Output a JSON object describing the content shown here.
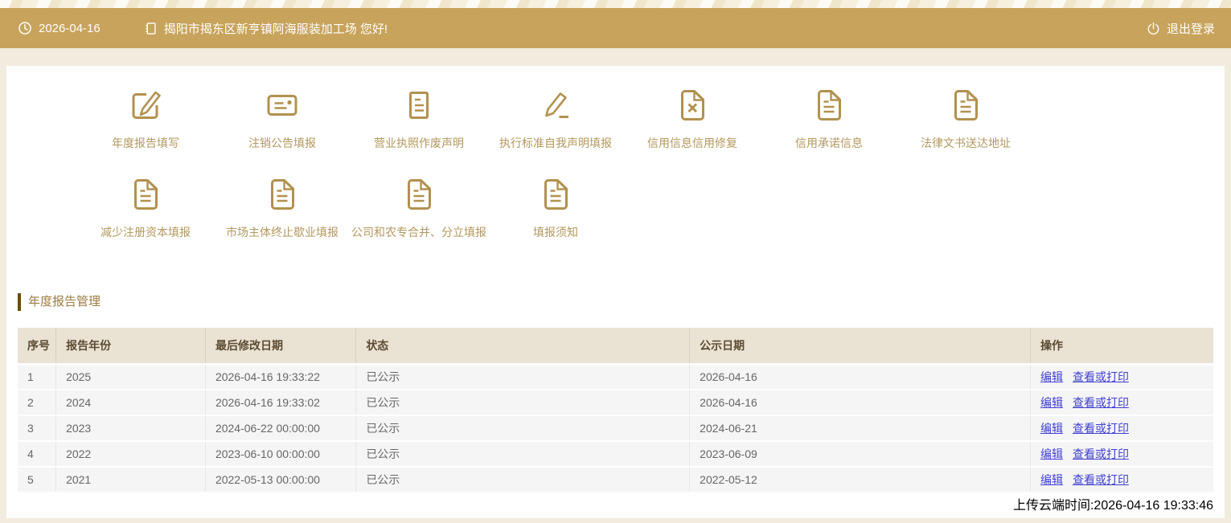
{
  "topbar": {
    "date": "2026-04-16",
    "welcome": "揭阳市揭东区新亨镇阿海服装加工场 您好!",
    "logout": "退出登录"
  },
  "menu": {
    "row1": [
      {
        "label": "年度报告填写",
        "icon": "edit-square-icon"
      },
      {
        "label": "注销公告填报",
        "icon": "card-note-icon"
      },
      {
        "label": "营业执照作废声明",
        "icon": "document-lines-icon"
      },
      {
        "label": "执行标准自我声明填报",
        "icon": "pencil-underline-icon"
      },
      {
        "label": "信用信息信用修复",
        "icon": "file-x-icon"
      },
      {
        "label": "信用承诺信息",
        "icon": "file-text-icon"
      },
      {
        "label": "法律文书送达地址",
        "icon": "file-text-icon"
      }
    ],
    "row2": [
      {
        "label": "减少注册资本填报",
        "icon": "file-text-icon"
      },
      {
        "label": "市场主体终止歇业填报",
        "icon": "file-text-icon"
      },
      {
        "label": "公司和农专合并、分立填报",
        "icon": "file-text-icon"
      },
      {
        "label": "填报须知",
        "icon": "file-text-icon"
      }
    ]
  },
  "section": {
    "title": "年度报告管理"
  },
  "table": {
    "headers": [
      "序号",
      "报告年份",
      "最后修改日期",
      "状态",
      "公示日期",
      "操作"
    ],
    "actions": {
      "edit": "编辑",
      "view": "查看或打印"
    },
    "rows": [
      {
        "no": "1",
        "year": "2025",
        "modified": "2026-04-16 19:33:22",
        "status": "已公示",
        "published": "2026-04-16"
      },
      {
        "no": "2",
        "year": "2024",
        "modified": "2026-04-16 19:33:02",
        "status": "已公示",
        "published": "2026-04-16"
      },
      {
        "no": "3",
        "year": "2023",
        "modified": "2024-06-22 00:00:00",
        "status": "已公示",
        "published": "2024-06-21"
      },
      {
        "no": "4",
        "year": "2022",
        "modified": "2023-06-10 00:00:00",
        "status": "已公示",
        "published": "2023-06-09"
      },
      {
        "no": "5",
        "year": "2021",
        "modified": "2022-05-13 00:00:00",
        "status": "已公示",
        "published": "2022-05-12"
      }
    ]
  },
  "footer": {
    "upload_time": "上传云端时间:2026-04-16 19:33:46"
  },
  "colors": {
    "page_bg": "#f1ecde",
    "topbar_gold": "#c7a35b",
    "topbar_text": "#ffffff",
    "icon_gold": "#b2914e",
    "menu_label_gold": "#b3985e",
    "section_title_bar": "#6b4a10",
    "section_title_text": "#9c7c42",
    "table_header_bg": "#eae2d3",
    "table_header_text": "#5c4b32",
    "table_row_bg": "#f5f5f5",
    "link_blue": "#3f3fd3"
  }
}
